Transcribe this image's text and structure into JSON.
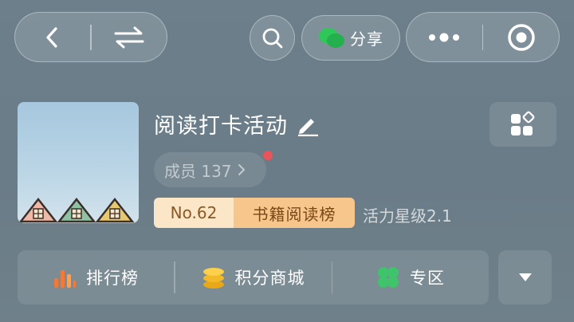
{
  "topbar": {
    "icons": [
      "back-arrow-icon",
      "switch-arrows-icon",
      "search-icon",
      "wechat-icon",
      "more-dots-icon",
      "target-circle-icon"
    ],
    "share_label": "分享"
  },
  "group": {
    "title": "阅读打卡活动",
    "members_label": "成员 137",
    "has_notification": true,
    "rank_number": "No.62",
    "rank_board": "书籍阅读榜",
    "vitality": "活力星级2.1",
    "colors": {
      "rank_bg": "#fbe6c7",
      "board_bg": "#f7c68c",
      "notify_dot": "#e8545a"
    }
  },
  "bottom": {
    "items": [
      {
        "label": "排行榜",
        "icon": "bar-chart-icon"
      },
      {
        "label": "积分商城",
        "icon": "coins-icon"
      },
      {
        "label": "专区",
        "icon": "clover-icon"
      }
    ],
    "expand_icon": "triangle-down-icon"
  }
}
